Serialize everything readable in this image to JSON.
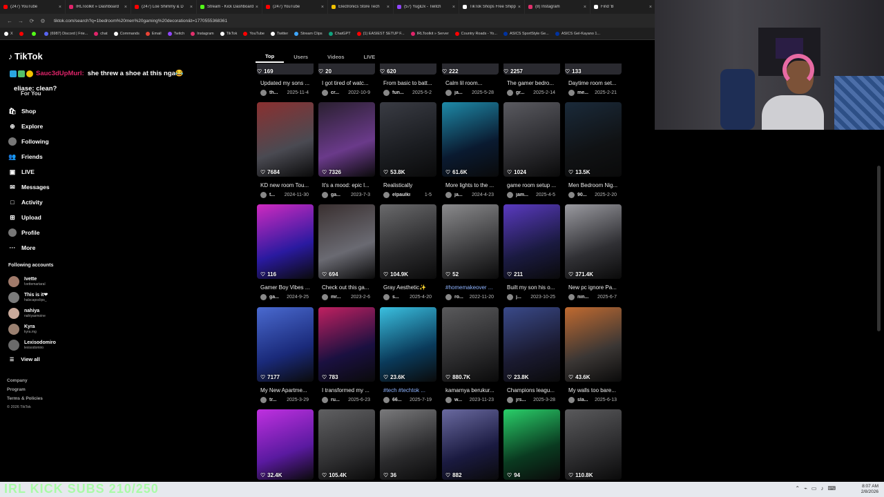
{
  "browser": {
    "tabs": [
      {
        "title": "(247) YouTube",
        "color": "#ff0000"
      },
      {
        "title": "IRLToolkit » Dashboard",
        "color": "#e0246a"
      },
      {
        "title": "(247) Loe Shimmy & D",
        "color": "#ff0000"
      },
      {
        "title": "Stream - Kick Dashboard",
        "color": "#53fc18"
      },
      {
        "title": "(247) YouTube",
        "color": "#ff0000"
      },
      {
        "title": "Electronics Store Tech",
        "color": "#f2c200"
      },
      {
        "title": "(57) YugiDx - Twitch",
        "color": "#9146ff"
      },
      {
        "title": "TikTok Shops Free Shipp",
        "color": "#ffffff"
      },
      {
        "title": "(8) Instagram",
        "color": "#e1306c"
      },
      {
        "title": "Find 'B",
        "color": "#ffffff"
      }
    ],
    "url": "tiktok.com/search?q=1bedroom%20men%20gaming%20decoration&t=1770555368361",
    "bookmarks": [
      {
        "label": "X",
        "color": "#ffffff"
      },
      {
        "label": "",
        "color": "#ff0000"
      },
      {
        "label": "",
        "color": "#53fc18"
      },
      {
        "label": "(6987) Discord | Frie...",
        "color": "#5865f2"
      },
      {
        "label": "chat",
        "color": "#e0246a"
      },
      {
        "label": "Commands",
        "color": "#ffffff"
      },
      {
        "label": "Email",
        "color": "#ea4335"
      },
      {
        "label": "Twitch",
        "color": "#9146ff"
      },
      {
        "label": "Instagram",
        "color": "#e1306c"
      },
      {
        "label": "TikTok",
        "color": "#ffffff"
      },
      {
        "label": "YouTube",
        "color": "#ff0000"
      },
      {
        "label": "Twitter",
        "color": "#ffffff"
      },
      {
        "label": "Stream Clips",
        "color": "#3ea6ff"
      },
      {
        "label": "ChatGPT",
        "color": "#10a37f"
      },
      {
        "label": "(1) EASIEST SETUP F...",
        "color": "#ff0000"
      },
      {
        "label": "IRLToolkit » Server",
        "color": "#e0246a"
      },
      {
        "label": "Country Roads - Yo...",
        "color": "#ff0000"
      },
      {
        "label": "ASICS SportStyle Ge...",
        "color": "#0033a0"
      },
      {
        "label": "ASICS Gel-Kayano 1...",
        "color": "#0033a0"
      }
    ]
  },
  "tiktok": {
    "logo": "TikTok",
    "chat_user": "Sauc3dUpMurl:",
    "chat_message": "she threw a shoe at this nga😂",
    "chat_line2": "eliase: clean?",
    "for_you": "For You",
    "nav": [
      {
        "label": "Shop",
        "icon": "shop-icon",
        "glyph": "🛍"
      },
      {
        "label": "Explore",
        "icon": "explore-icon",
        "glyph": "⊕"
      },
      {
        "label": "Following",
        "icon": "following-avatar",
        "glyph": ""
      },
      {
        "label": "Friends",
        "icon": "friends-icon",
        "glyph": "👥"
      },
      {
        "label": "LIVE",
        "icon": "live-icon",
        "glyph": "▣"
      },
      {
        "label": "Messages",
        "icon": "messages-icon",
        "glyph": "✉"
      },
      {
        "label": "Activity",
        "icon": "activity-icon",
        "glyph": "□"
      },
      {
        "label": "Upload",
        "icon": "upload-icon",
        "glyph": "⊞"
      },
      {
        "label": "Profile",
        "icon": "profile-avatar",
        "glyph": ""
      },
      {
        "label": "More",
        "icon": "more-icon",
        "glyph": "···"
      }
    ],
    "following_title": "Following accounts",
    "following": [
      {
        "name": "Ivette",
        "handle": "Ivettemartaral",
        "color": "#a07a6a"
      },
      {
        "name": "This is it❤",
        "handle": "halscapsclips_",
        "color": "#7a7a7a"
      },
      {
        "name": "nahiya",
        "handle": "nahiyasmoine",
        "color": "#c9a99a"
      },
      {
        "name": "Kyra",
        "handle": "kyra.mg",
        "color": "#9a8070"
      },
      {
        "name": "Lexisodomiro",
        "handle": "lexisodomiro",
        "color": "#6a6a6a"
      }
    ],
    "view_all": "View all",
    "footer": [
      "Company",
      "Program",
      "Terms & Policies"
    ],
    "copyright": "© 2026 TikTok",
    "search_tabs": [
      "Top",
      "Users",
      "Videos",
      "LIVE"
    ],
    "active_tab": "Top"
  },
  "top_row": [
    {
      "likes": "169",
      "desc": "Updated my sons ...",
      "user": "th...",
      "date": "2025-11-4"
    },
    {
      "likes": "20",
      "desc": "I got tired of watc...",
      "user": "cr...",
      "date": "2022-10-9"
    },
    {
      "likes": "620",
      "desc": "From basic to batt...",
      "user": "fun...",
      "date": "2025-5-2"
    },
    {
      "likes": "222",
      "desc": "Calm lil room...",
      "user": "ja...",
      "date": "2025-5-28"
    },
    {
      "likes": "2257",
      "desc": "The gamer bedro...",
      "user": "gr...",
      "date": "2025-2-14"
    },
    {
      "likes": "133",
      "desc": "Daytime room set...",
      "user": "me...",
      "date": "2025-2-21"
    }
  ],
  "videos": [
    [
      {
        "likes": "7684",
        "desc": "KD new room Tou...",
        "user": "t...",
        "date": "2024-11-30",
        "bg": [
          "#4a4a52",
          "#8a3030"
        ]
      },
      {
        "likes": "7326",
        "desc": "It's a mood: epic l...",
        "user": "ga...",
        "date": "2023-7-3",
        "bg": [
          "#6a3a8a",
          "#2a2030"
        ]
      },
      {
        "likes": "53.8K",
        "desc": "Realistically",
        "user": "elpaulkris",
        "date": "1-5",
        "bg": [
          "#1a1c20",
          "#3a3c44"
        ]
      },
      {
        "likes": "61.6K",
        "desc": "More lights to the ...",
        "user": "ja...",
        "date": "2024-4-23",
        "bg": [
          "#0a1a30",
          "#1e8aa8"
        ]
      },
      {
        "likes": "1024",
        "desc": "game room setup ...",
        "user": "jam...",
        "date": "2025-4-5",
        "bg": [
          "#2a2a2e",
          "#5a5a60"
        ]
      },
      {
        "likes": "13.5K",
        "desc": "Men Bedroom Nig...",
        "user": "90...",
        "date": "2025-2-20",
        "bg": [
          "#101214",
          "#1a2a3a"
        ]
      }
    ],
    [
      {
        "likes": "116",
        "desc": "Gamer Boy Vibes ...",
        "user": "ga...",
        "date": "2024-9-25",
        "bg": [
          "#2a1aa0",
          "#d02ac0"
        ]
      },
      {
        "likes": "694",
        "desc": "Check out this ga...",
        "user": "mr...",
        "date": "2023-2-6",
        "bg": [
          "#6a6a72",
          "#3a3030"
        ]
      },
      {
        "likes": "104.9K",
        "desc": "Gray Aesthetic✨",
        "user": "s...",
        "date": "2025-4-20",
        "bg": [
          "#2a2a2c",
          "#6a6a6c"
        ]
      },
      {
        "likes": "52",
        "desc": "#homemakeover ...",
        "user": "ro...",
        "date": "2022-11-20",
        "bg": [
          "#3a3a3c",
          "#8a8a8c"
        ],
        "tag": true
      },
      {
        "likes": "211",
        "desc": "Built my son his o...",
        "user": "j...",
        "date": "2023-10-25",
        "bg": [
          "#1a1a40",
          "#5a3ac0"
        ]
      },
      {
        "likes": "371.4K",
        "desc": "New pc ignore Pa...",
        "user": "nin...",
        "date": "2025-6-7",
        "bg": [
          "#303034",
          "#9a9aa0"
        ]
      }
    ],
    [
      {
        "likes": "7177",
        "desc": "My New Apartme...",
        "user": "tr...",
        "date": "2025-3-29",
        "bg": [
          "#1a2a7a",
          "#4a6ad0"
        ]
      },
      {
        "likes": "783",
        "desc": "I transformed my ...",
        "user": "ru...",
        "date": "2025-6-23",
        "bg": [
          "#1a1040",
          "#c02060"
        ]
      },
      {
        "likes": "23.6K",
        "desc": "#tech #techtok ...",
        "user": "66...",
        "date": "2025-7-19",
        "bg": [
          "#0a3a5a",
          "#3ac0e0"
        ],
        "tag": true
      },
      {
        "likes": "880.7K",
        "desc": "kamarnya berukur...",
        "user": "w...",
        "date": "2023-11-23",
        "bg": [
          "#2a2a2c",
          "#5a5a5c"
        ]
      },
      {
        "likes": "23.8K",
        "desc": "Champions leagu...",
        "user": "jrs...",
        "date": "2025-3-28",
        "bg": [
          "#1a1a30",
          "#3a4a8a"
        ]
      },
      {
        "likes": "43.6K",
        "desc": "My walls too bare...",
        "user": "sla...",
        "date": "2025-6-13",
        "bg": [
          "#3a3634",
          "#c06a30"
        ]
      }
    ],
    [
      {
        "likes": "32.4K",
        "desc": "",
        "user": "",
        "date": "",
        "bg": [
          "#5a1aa0",
          "#c030e0"
        ]
      },
      {
        "likes": "105.4K",
        "desc": "",
        "user": "",
        "date": "",
        "bg": [
          "#303032",
          "#606062"
        ]
      },
      {
        "likes": "36",
        "desc": "",
        "user": "",
        "date": "",
        "bg": [
          "#2a2a2c",
          "#7a7a7c"
        ]
      },
      {
        "likes": "882",
        "desc": "",
        "user": "",
        "date": "",
        "bg": [
          "#1a1a40",
          "#6a6aa0"
        ]
      },
      {
        "likes": "94",
        "desc": "",
        "user": "",
        "date": "",
        "bg": [
          "#0a3a20",
          "#2ad06a"
        ]
      },
      {
        "likes": "110.8K",
        "desc": "",
        "user": "",
        "date": "",
        "bg": [
          "#2a2a2c",
          "#5a5a5c"
        ]
      }
    ]
  ],
  "overlay_text": "IRL KICK SUBS 210/250",
  "clock": {
    "time": "8:07 AM",
    "date": "2/8/2026"
  }
}
